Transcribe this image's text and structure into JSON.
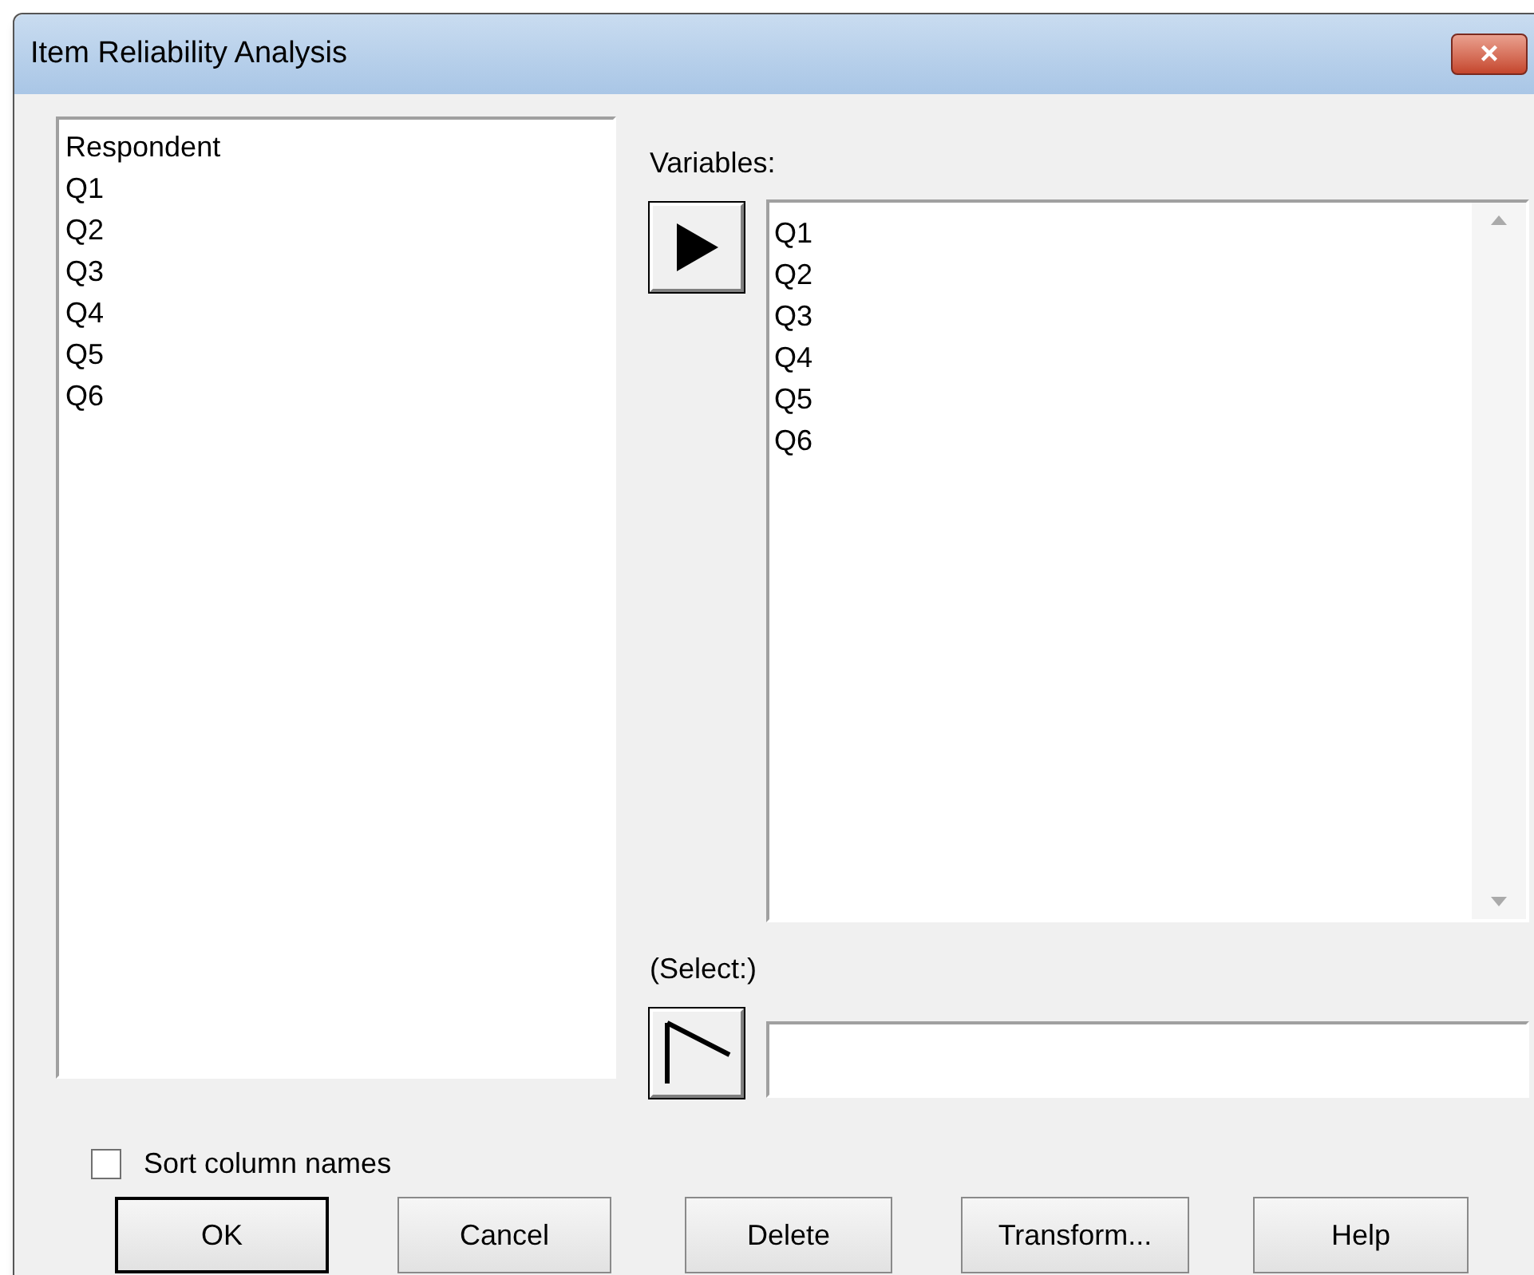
{
  "window": {
    "title": "Item Reliability Analysis",
    "close": "×"
  },
  "source_list": {
    "items": [
      "Respondent",
      "Q1",
      "Q2",
      "Q3",
      "Q4",
      "Q5",
      "Q6"
    ]
  },
  "variables": {
    "label": "Variables:",
    "items": [
      "Q1",
      "Q2",
      "Q3",
      "Q4",
      "Q5",
      "Q6"
    ]
  },
  "select": {
    "label": "(Select:)"
  },
  "sort_checkbox": {
    "label": "Sort column names",
    "checked": false
  },
  "buttons": [
    {
      "label": "OK",
      "default": true
    },
    {
      "label": "Cancel",
      "default": false
    },
    {
      "label": "Delete",
      "default": false
    },
    {
      "label": "Transform...",
      "default": false
    },
    {
      "label": "Help",
      "default": false
    }
  ]
}
